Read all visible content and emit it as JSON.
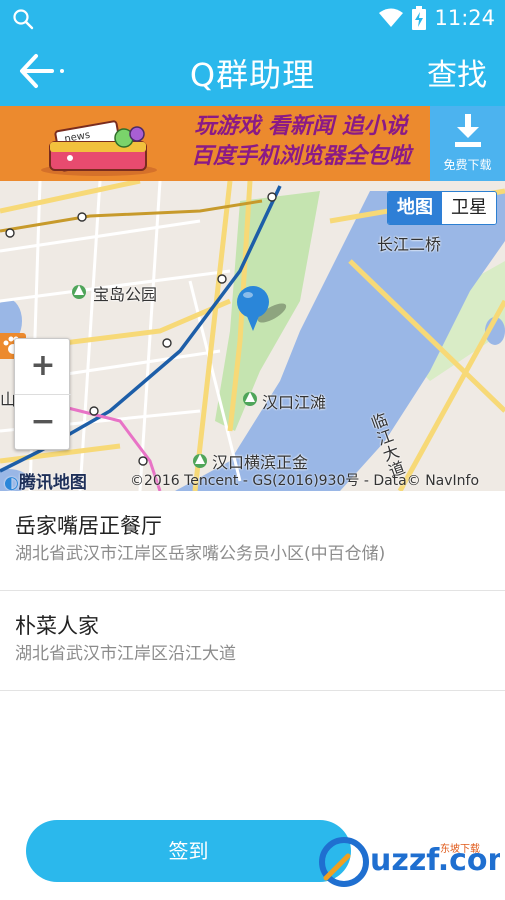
{
  "status_bar": {
    "time": "11:24"
  },
  "header": {
    "title": "Q群助理",
    "search_label": "查找"
  },
  "ad": {
    "line1": "玩游戏 看新闻 追小说",
    "line2": "百度手机浏览器全包啦",
    "download_label": "免费下载",
    "illustration_text": "news",
    "corner_text": "广告"
  },
  "map": {
    "toggle_map": "地图",
    "toggle_satellite": "卫星",
    "labels": {
      "park": "宝岛公园",
      "bridge": "长江二桥",
      "beach": "汉口江滩",
      "avenue": "临江大道",
      "street": "汉口横滨正金",
      "left_cut": "山"
    },
    "logo": "腾讯地图",
    "copyright": "©2016 Tencent - GS(2016)930号 - Data© NavInfo",
    "zoom_in": "+",
    "zoom_out": "−"
  },
  "places": [
    {
      "name": "岳家嘴居正餐厅",
      "address": "湖北省武汉市江岸区岳家嘴公务员小区(中百仓储)"
    },
    {
      "name": "朴菜人家",
      "address": "湖北省武汉市江岸区沿江大道"
    }
  ],
  "checkin_label": "签到",
  "watermark": {
    "main": "uzzf.com",
    "sub": "东坡下载"
  },
  "colors": {
    "primary": "#2bb8ec",
    "ad_orange": "#ec8a2e",
    "river": "#9ab7e6",
    "park": "#c5e4b0"
  }
}
